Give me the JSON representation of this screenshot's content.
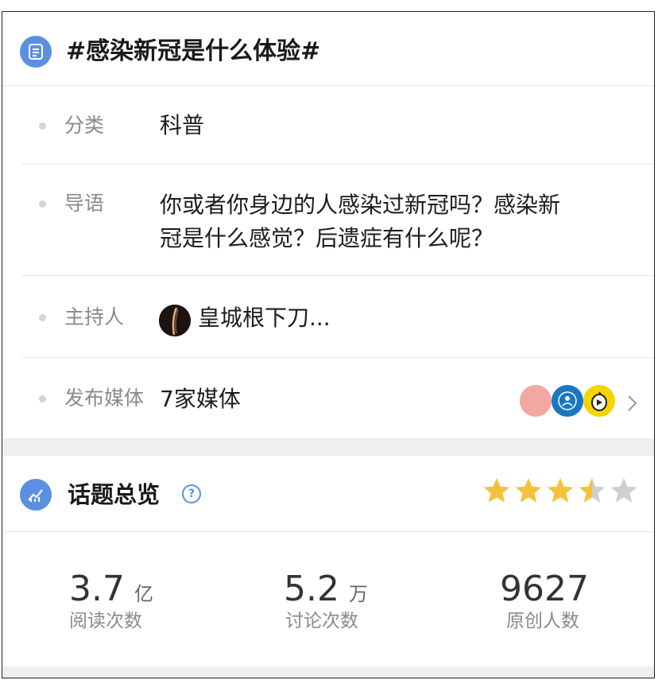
{
  "topic": {
    "title": "#感染新冠是什么体验#"
  },
  "details": {
    "category_label": "分类",
    "category_value": "科普",
    "intro_label": "导语",
    "intro_line1": "你或者你身边的人感染过新冠吗？感染新",
    "intro_line2": "冠是什么感觉？后遗症有什么呢？",
    "host_label": "主持人",
    "host_name": "皇城根下刀...",
    "media_label": "发布媒体",
    "media_value": "7家媒体",
    "media_avatar_colors": [
      "#f2a7a3",
      "#1a78c2",
      "#f5d400"
    ]
  },
  "overview": {
    "title": "话题总览",
    "help_icon_text": "?",
    "rating": 3.5,
    "rating_max": 5,
    "star_color": "#f5c13b",
    "star_empty_color": "#cfcfcf"
  },
  "stats": [
    {
      "value": "3.7",
      "unit": "亿",
      "label": "阅读次数"
    },
    {
      "value": "5.2",
      "unit": "万",
      "label": "讨论次数"
    },
    {
      "value": "9627",
      "unit": "",
      "label": "原创人数"
    }
  ],
  "colors": {
    "accent": "#5b8fe0"
  }
}
